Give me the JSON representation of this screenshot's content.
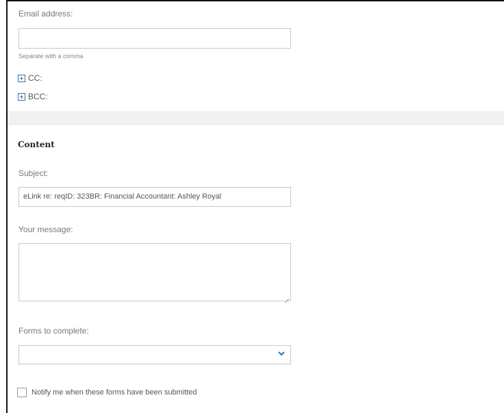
{
  "recipients": {
    "email_label": "Email address:",
    "email_value": "",
    "email_hint": "Separate with a comma",
    "cc_label": "CC:",
    "bcc_label": "BCC:"
  },
  "content": {
    "section_title": "Content",
    "subject_label": "Subject:",
    "subject_value": "eLink re: reqID: 323BR: Financial Accountant: Ashley Royal",
    "message_label": "Your message:",
    "message_value": "",
    "forms_label": "Forms to complete:",
    "forms_selected": "",
    "notify_label": "Notify me when these forms have been submitted",
    "notify_checked": false
  },
  "icons": {
    "expand": "plus-square-icon",
    "dropdown": "chevron-down-icon",
    "resize": "resize-grip-icon"
  },
  "colors": {
    "accent": "#2f6fb4",
    "section_band": "#f1f1f1"
  }
}
